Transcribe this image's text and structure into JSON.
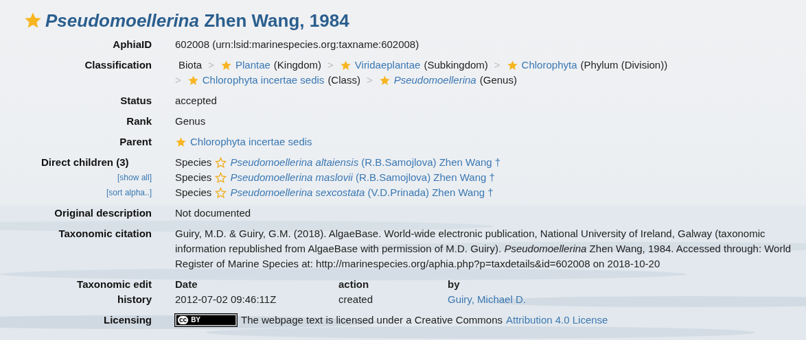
{
  "title": {
    "text": "*Pseudomoellerina* Zhen Wang, 1984",
    "starred": true
  },
  "aphia_id": {
    "label": "AphiaID",
    "value": "602008  (urn:lsid:marinespecies.org:taxname:602008)"
  },
  "classification": {
    "label": "Classification",
    "items": [
      {
        "name": "Biota",
        "link": false
      },
      {
        "separator": ">",
        "starred": true,
        "name": "Plantae",
        "rank": "(Kingdom)",
        "link": true
      },
      {
        "separator": ">",
        "starred": true,
        "name": "Viridaeplantae",
        "rank": "(Subkingdom)",
        "link": true
      },
      {
        "separator": ">",
        "starred": true,
        "name": "Chlorophyta",
        "rank": "(Phylum (Division))",
        "link": true
      },
      {
        "separator": ">",
        "starred": true,
        "name": "Chlorophyta incertae sedis",
        "rank": "(Class)",
        "link": true
      },
      {
        "separator": ">",
        "starred": true,
        "name": "*Pseudomoellerina*",
        "rank": "(Genus)",
        "link": true
      }
    ]
  },
  "status": {
    "label": "Status",
    "value": "accepted"
  },
  "rank": {
    "label": "Rank",
    "value": "Genus"
  },
  "parent": {
    "label": "Parent",
    "starred": true,
    "name": "Chlorophyta incertae sedis"
  },
  "children": {
    "label": "Direct children (3)",
    "links": [
      "[show all]",
      "[sort alpha..]"
    ],
    "items": [
      {
        "rank": "Species",
        "starred": false,
        "name": "*Pseudomoellerina altaiensis* (R.B.Samojlova) Zhen Wang †"
      },
      {
        "rank": "Species",
        "starred": false,
        "name": "*Pseudomoellerina maslovii* (R.B.Samojlova) Zhen Wang †"
      },
      {
        "rank": "Species",
        "starred": false,
        "name": "*Pseudomoellerina sexcostata* (V.D.Prinada) Zhen Wang †"
      }
    ]
  },
  "original_description": {
    "label": "Original description",
    "value": "Not documented"
  },
  "citation": {
    "label": "Taxonomic citation",
    "value": "Guiry, M.D. & Guiry, G.M. (2018). AlgaeBase. World-wide electronic publication, National University of Ireland, Galway (taxonomic information republished from AlgaeBase with permission of M.D. Guiry). *Pseudomoellerina* Zhen Wang, 1984. Accessed through: World Register of Marine Species at: http://marinespecies.org/aphia.php?p=taxdetails&id=602008 on 2018-10-20"
  },
  "edit_history": {
    "label": "Taxonomic edit history",
    "columns": [
      "Date",
      "action",
      "by"
    ],
    "rows": [
      {
        "date": "2012-07-02 09:46:11Z",
        "action": "created",
        "by": "Guiry, Michael D."
      }
    ]
  },
  "licensing": {
    "label": "Licensing",
    "badge_logo": "cc",
    "badge_text": "BY",
    "text": "The webpage text is licensed under a Creative Commons",
    "link": "Attribution 4.0 License"
  }
}
